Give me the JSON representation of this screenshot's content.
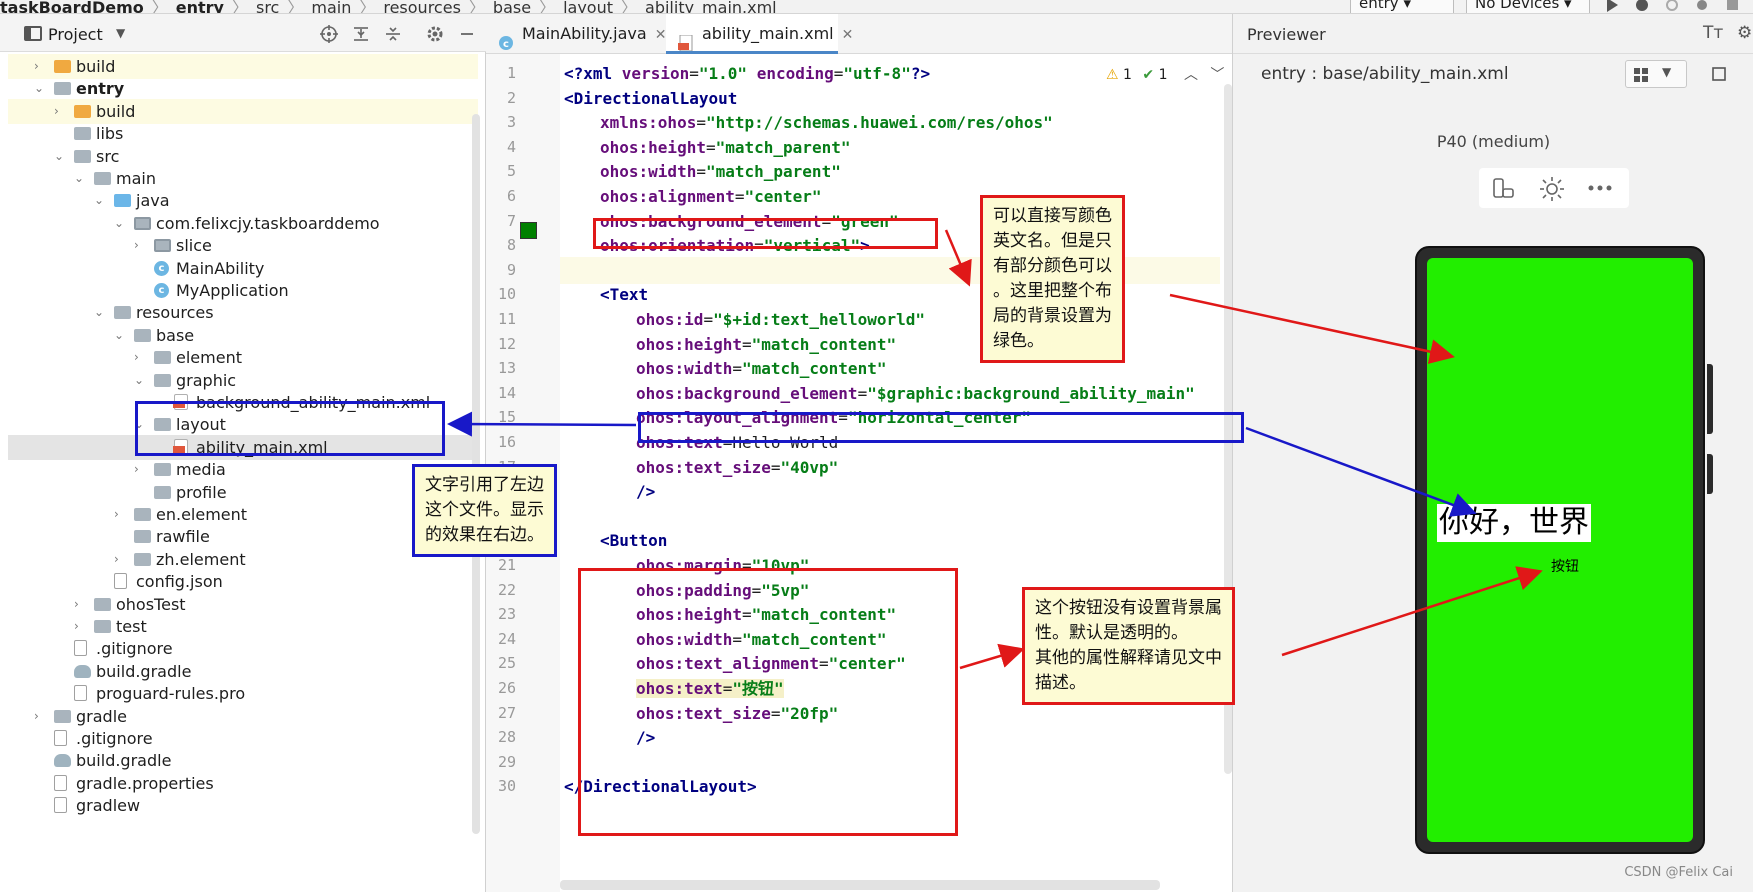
{
  "breadcrumb": {
    "items": [
      "taskBoardDemo",
      "entry",
      "src",
      "main",
      "resources",
      "base",
      "layout",
      "ability_main.xml"
    ]
  },
  "toolbar": {
    "run_config": "entry",
    "device_select": "No Devices"
  },
  "project_panel": {
    "title": "Project",
    "tree": [
      {
        "label": "build",
        "depth": 1,
        "icon": "folder-orange",
        "expand": "collapsed",
        "highlight": "yellow"
      },
      {
        "label": "entry",
        "depth": 1,
        "icon": "module-folder",
        "expand": "expanded",
        "bold": true
      },
      {
        "label": "build",
        "depth": 2,
        "icon": "folder-orange",
        "expand": "collapsed",
        "highlight": "yellow"
      },
      {
        "label": "libs",
        "depth": 2,
        "icon": "folder-gray",
        "expand": "none"
      },
      {
        "label": "src",
        "depth": 2,
        "icon": "folder-gray",
        "expand": "expanded"
      },
      {
        "label": "main",
        "depth": 3,
        "icon": "folder-gray",
        "expand": "expanded"
      },
      {
        "label": "java",
        "depth": 4,
        "icon": "folder-blue",
        "expand": "expanded"
      },
      {
        "label": "com.felixcjy.taskboarddemo",
        "depth": 5,
        "icon": "package",
        "expand": "expanded"
      },
      {
        "label": "slice",
        "depth": 6,
        "icon": "package",
        "expand": "collapsed"
      },
      {
        "label": "MainAbility",
        "depth": 6,
        "icon": "class",
        "expand": "none"
      },
      {
        "label": "MyApplication",
        "depth": 6,
        "icon": "class",
        "expand": "none"
      },
      {
        "label": "resources",
        "depth": 4,
        "icon": "folder-gray",
        "expand": "expanded"
      },
      {
        "label": "base",
        "depth": 5,
        "icon": "folder-gray",
        "expand": "expanded"
      },
      {
        "label": "element",
        "depth": 6,
        "icon": "folder-gray",
        "expand": "collapsed"
      },
      {
        "label": "graphic",
        "depth": 6,
        "icon": "folder-gray",
        "expand": "expanded"
      },
      {
        "label": "background_ability_main.xml",
        "depth": 7,
        "icon": "xml",
        "expand": "none"
      },
      {
        "label": "layout",
        "depth": 6,
        "icon": "folder-gray",
        "expand": "expanded"
      },
      {
        "label": "ability_main.xml",
        "depth": 7,
        "icon": "xml",
        "expand": "none",
        "highlight": "selected"
      },
      {
        "label": "media",
        "depth": 6,
        "icon": "folder-gray",
        "expand": "collapsed"
      },
      {
        "label": "profile",
        "depth": 6,
        "icon": "folder-gray",
        "expand": "none"
      },
      {
        "label": "en.element",
        "depth": 5,
        "icon": "folder-gray",
        "expand": "collapsed"
      },
      {
        "label": "rawfile",
        "depth": 5,
        "icon": "folder-gray",
        "expand": "none"
      },
      {
        "label": "zh.element",
        "depth": 5,
        "icon": "folder-gray",
        "expand": "collapsed"
      },
      {
        "label": "config.json",
        "depth": 4,
        "icon": "file",
        "expand": "none"
      },
      {
        "label": "ohosTest",
        "depth": 3,
        "icon": "folder-gray",
        "expand": "collapsed"
      },
      {
        "label": "test",
        "depth": 3,
        "icon": "folder-gray",
        "expand": "collapsed"
      },
      {
        "label": ".gitignore",
        "depth": 2,
        "icon": "file",
        "expand": "none"
      },
      {
        "label": "build.gradle",
        "depth": 2,
        "icon": "gradle",
        "expand": "none"
      },
      {
        "label": "proguard-rules.pro",
        "depth": 2,
        "icon": "file",
        "expand": "none"
      },
      {
        "label": "gradle",
        "depth": 1,
        "icon": "folder-gray",
        "expand": "collapsed"
      },
      {
        "label": ".gitignore",
        "depth": 1,
        "icon": "file",
        "expand": "none"
      },
      {
        "label": "build.gradle",
        "depth": 1,
        "icon": "gradle",
        "expand": "none"
      },
      {
        "label": "gradle.properties",
        "depth": 1,
        "icon": "file",
        "expand": "none"
      },
      {
        "label": "gradlew",
        "depth": 1,
        "icon": "file",
        "expand": "none"
      }
    ]
  },
  "editor": {
    "tabs": [
      {
        "label": "MainAbility.java",
        "icon": "class",
        "active": false
      },
      {
        "label": "ability_main.xml",
        "icon": "xml",
        "active": true
      }
    ],
    "inspections": {
      "warnings": "1",
      "ok": "1"
    },
    "lines": [
      {
        "n": "1",
        "indent": 0,
        "parts": [
          [
            "pi",
            "<?xml "
          ],
          [
            "attr",
            "version"
          ],
          [
            "plain",
            "="
          ],
          [
            "val",
            "\"1.0\""
          ],
          [
            "plain",
            " "
          ],
          [
            "attr",
            "encoding"
          ],
          [
            "plain",
            "="
          ],
          [
            "val",
            "\"utf-8\""
          ],
          [
            "pi",
            "?>"
          ]
        ]
      },
      {
        "n": "2",
        "indent": 0,
        "parts": [
          [
            "tag",
            "<DirectionalLayout"
          ]
        ]
      },
      {
        "n": "3",
        "indent": 1,
        "parts": [
          [
            "ns",
            "xmlns:ohos"
          ],
          [
            "plain",
            "="
          ],
          [
            "val",
            "\"http://schemas.huawei.com/res/ohos\""
          ]
        ]
      },
      {
        "n": "4",
        "indent": 1,
        "parts": [
          [
            "ns",
            "ohos:height"
          ],
          [
            "plain",
            "="
          ],
          [
            "val",
            "\"match_parent\""
          ]
        ]
      },
      {
        "n": "5",
        "indent": 1,
        "parts": [
          [
            "ns",
            "ohos:width"
          ],
          [
            "plain",
            "="
          ],
          [
            "val",
            "\"match_parent\""
          ]
        ]
      },
      {
        "n": "6",
        "indent": 1,
        "parts": [
          [
            "ns",
            "ohos:alignment"
          ],
          [
            "plain",
            "="
          ],
          [
            "val",
            "\"center\""
          ]
        ]
      },
      {
        "n": "7",
        "indent": 1,
        "parts": [
          [
            "ns",
            "ohos:background_element"
          ],
          [
            "plain",
            "="
          ],
          [
            "val",
            "\"green\""
          ]
        ]
      },
      {
        "n": "8",
        "indent": 1,
        "parts": [
          [
            "ns",
            "ohos:orientation"
          ],
          [
            "plain",
            "="
          ],
          [
            "val",
            "\"vertical\""
          ],
          [
            "tag",
            ">"
          ]
        ]
      },
      {
        "n": "9",
        "indent": 0,
        "parts": [
          [
            "plain",
            ""
          ]
        ],
        "current": true
      },
      {
        "n": "10",
        "indent": 1,
        "parts": [
          [
            "tag",
            "<Text"
          ]
        ]
      },
      {
        "n": "11",
        "indent": 2,
        "parts": [
          [
            "ns",
            "ohos:id"
          ],
          [
            "plain",
            "="
          ],
          [
            "val",
            "\"$+id:text_helloworld\""
          ]
        ]
      },
      {
        "n": "12",
        "indent": 2,
        "parts": [
          [
            "ns",
            "ohos:height"
          ],
          [
            "plain",
            "="
          ],
          [
            "val",
            "\"match_content\""
          ]
        ]
      },
      {
        "n": "13",
        "indent": 2,
        "parts": [
          [
            "ns",
            "ohos:width"
          ],
          [
            "plain",
            "="
          ],
          [
            "val",
            "\"match_content\""
          ]
        ]
      },
      {
        "n": "14",
        "indent": 2,
        "parts": [
          [
            "ns",
            "ohos:background_element"
          ],
          [
            "plain",
            "="
          ],
          [
            "val",
            "\"$graphic:background_ability_main\""
          ]
        ]
      },
      {
        "n": "15",
        "indent": 2,
        "parts": [
          [
            "ns",
            "ohos:layout_alignment"
          ],
          [
            "plain",
            "="
          ],
          [
            "val",
            "\"horizontal_center\""
          ]
        ]
      },
      {
        "n": "16",
        "indent": 2,
        "parts": [
          [
            "ns",
            "ohos:text"
          ],
          [
            "plain",
            "=Hello World"
          ]
        ]
      },
      {
        "n": "17",
        "indent": 2,
        "parts": [
          [
            "ns",
            "ohos:text_size"
          ],
          [
            "plain",
            "="
          ],
          [
            "val",
            "\"40vp\""
          ]
        ]
      },
      {
        "n": "18",
        "indent": 2,
        "parts": [
          [
            "tag",
            "/>"
          ]
        ]
      },
      {
        "n": "19",
        "indent": 0,
        "parts": [
          [
            "plain",
            ""
          ]
        ]
      },
      {
        "n": "20",
        "indent": 1,
        "parts": [
          [
            "tag",
            "<Button"
          ]
        ]
      },
      {
        "n": "21",
        "indent": 2,
        "parts": [
          [
            "ns",
            "ohos:margin"
          ],
          [
            "plain",
            "="
          ],
          [
            "val",
            "\"10vp\""
          ]
        ]
      },
      {
        "n": "22",
        "indent": 2,
        "parts": [
          [
            "ns",
            "ohos:padding"
          ],
          [
            "plain",
            "="
          ],
          [
            "val",
            "\"5vp\""
          ]
        ]
      },
      {
        "n": "23",
        "indent": 2,
        "parts": [
          [
            "ns",
            "ohos:height"
          ],
          [
            "plain",
            "="
          ],
          [
            "val",
            "\"match_content\""
          ]
        ]
      },
      {
        "n": "24",
        "indent": 2,
        "parts": [
          [
            "ns",
            "ohos:width"
          ],
          [
            "plain",
            "="
          ],
          [
            "val",
            "\"match_content\""
          ]
        ]
      },
      {
        "n": "25",
        "indent": 2,
        "parts": [
          [
            "ns",
            "ohos:text_alignment"
          ],
          [
            "plain",
            "="
          ],
          [
            "val",
            "\"center\""
          ]
        ]
      },
      {
        "n": "26",
        "indent": 2,
        "parts": [
          [
            "ns",
            "ohos:text"
          ],
          [
            "plain",
            "="
          ],
          [
            "val",
            "\"按钮\""
          ]
        ],
        "hl": true
      },
      {
        "n": "27",
        "indent": 2,
        "parts": [
          [
            "ns",
            "ohos:text_size"
          ],
          [
            "plain",
            "="
          ],
          [
            "val",
            "\"20fp\""
          ]
        ]
      },
      {
        "n": "28",
        "indent": 2,
        "parts": [
          [
            "tag",
            "/>"
          ]
        ]
      },
      {
        "n": "29",
        "indent": 0,
        "parts": [
          [
            "plain",
            ""
          ]
        ]
      },
      {
        "n": "30",
        "indent": 0,
        "parts": [
          [
            "tag",
            "</DirectionalLayout>"
          ]
        ]
      }
    ],
    "swatch_color": "#008000"
  },
  "previewer": {
    "title": "Previewer",
    "path": "entry : base/ability_main.xml",
    "device": "P40 (medium)",
    "screen_color": "#22ee00",
    "hello_text": "你好，世界",
    "button_text": "按钮"
  },
  "annotations": {
    "note_background": "可以直接写颜色\n英文名。但是只\n有部分颜色可以\n。这里把整个布\n局的背景设置为\n绿色。",
    "note_graphic": "文字引用了左边\n这个文件。显示\n的效果在右边。",
    "note_button": "这个按钮没有设置背景属\n性。默认是透明的。\n其他的属性解释请见文中\n描述。",
    "red_color": "#e01818",
    "blue_color": "#1818c8"
  },
  "watermark": "CSDN @Felix Cai"
}
